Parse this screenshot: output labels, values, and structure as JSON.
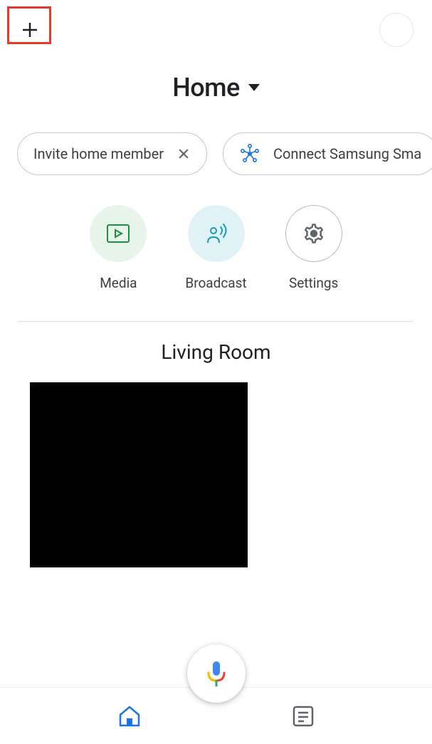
{
  "header": {
    "home_label": "Home"
  },
  "chips": [
    {
      "label": "Invite home member"
    },
    {
      "label": "Connect Samsung Sma"
    }
  ],
  "actions": [
    {
      "label": "Media"
    },
    {
      "label": "Broadcast"
    },
    {
      "label": "Settings"
    }
  ],
  "room": {
    "name": "Living Room"
  }
}
